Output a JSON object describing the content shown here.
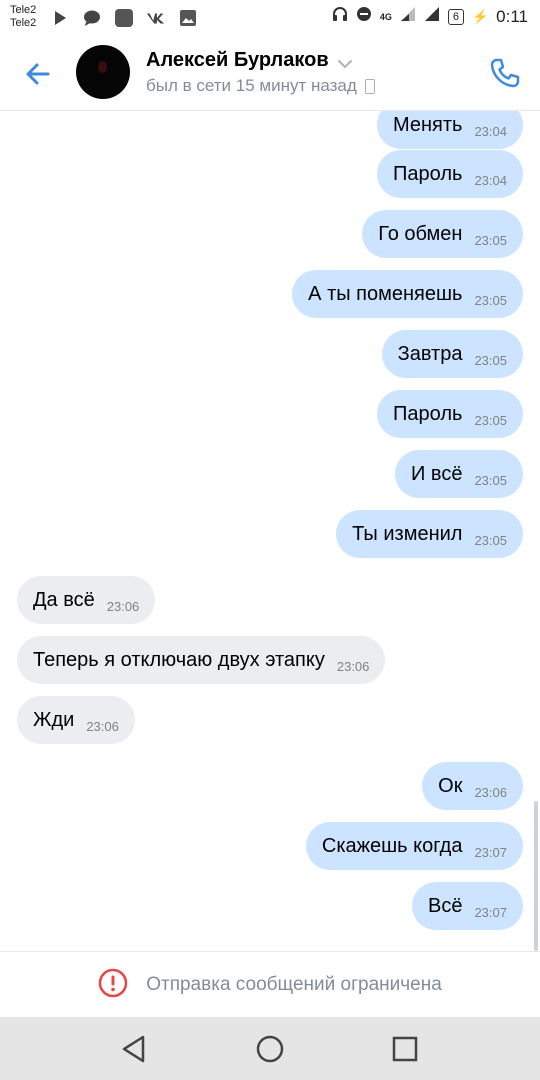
{
  "status_bar": {
    "carrier_1": "Tele2",
    "carrier_2": "Tele2",
    "left_icons": [
      "play-icon",
      "chat-icon",
      "app-icon",
      "vk-icon",
      "image-icon"
    ],
    "network": "4G",
    "battery": "6",
    "time": "0:11"
  },
  "header": {
    "name": "Алексей Бурлаков",
    "status": "был в сети 15 минут назад"
  },
  "messages": [
    {
      "dir": "out",
      "text": "Менять",
      "time": "23:04"
    },
    {
      "dir": "out",
      "text": "Пароль",
      "time": "23:04"
    },
    {
      "dir": "out",
      "text": "Го обмен",
      "time": "23:05"
    },
    {
      "dir": "out",
      "text": "А ты поменяешь",
      "time": "23:05"
    },
    {
      "dir": "out",
      "text": "Завтра",
      "time": "23:05"
    },
    {
      "dir": "out",
      "text": "Пароль",
      "time": "23:05"
    },
    {
      "dir": "out",
      "text": "И всё",
      "time": "23:05"
    },
    {
      "dir": "out",
      "text": "Ты изменил",
      "time": "23:05"
    },
    {
      "dir": "in",
      "text": "Да всё",
      "time": "23:06"
    },
    {
      "dir": "in",
      "text": "Теперь я отключаю двух этапку",
      "time": "23:06"
    },
    {
      "dir": "in",
      "text": "Жди",
      "time": "23:06"
    },
    {
      "dir": "out",
      "text": "Ок",
      "time": "23:06"
    },
    {
      "dir": "out",
      "text": "Скажешь когда",
      "time": "23:07"
    },
    {
      "dir": "out",
      "text": "Всё",
      "time": "23:07"
    }
  ],
  "restriction": {
    "text": "Отправка сообщений ограничена"
  },
  "colors": {
    "accent": "#3f8ae0",
    "outgoing_bubble": "#cce4ff",
    "incoming_bubble": "#ebedf0",
    "warning": "#e64646"
  }
}
